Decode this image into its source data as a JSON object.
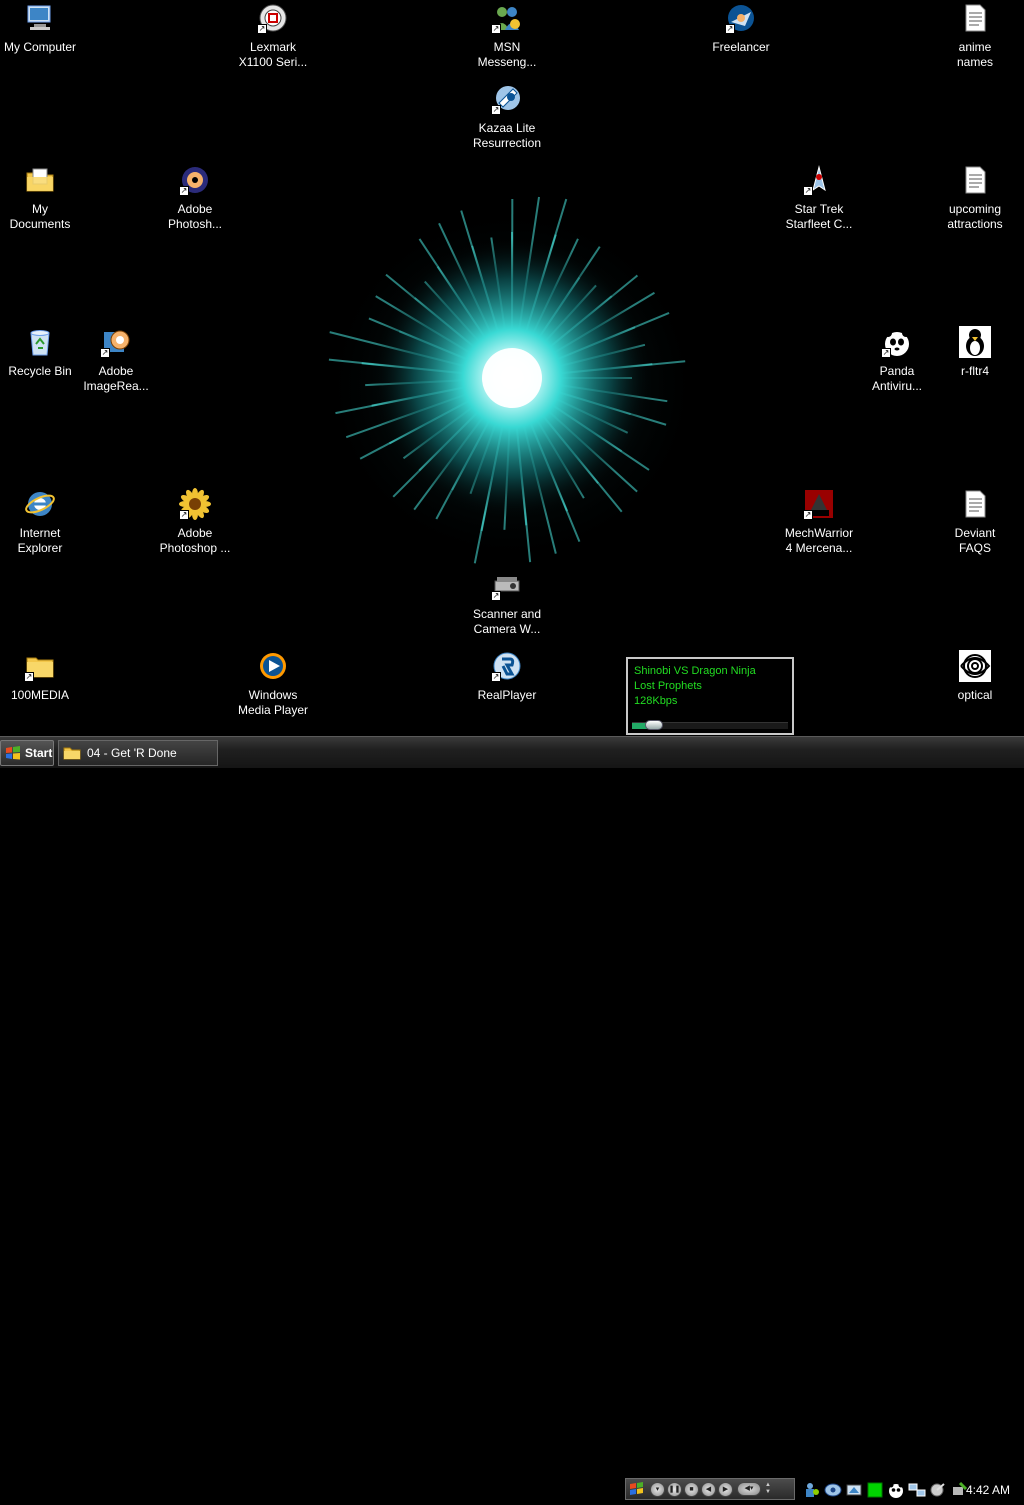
{
  "desktop": {
    "icons": [
      {
        "id": "my-computer",
        "label": "My Computer",
        "icon": "computer-icon",
        "shortcut": false
      },
      {
        "id": "lexmark",
        "label": "Lexmark\nX1100 Seri...",
        "icon": "printer-icon",
        "shortcut": true
      },
      {
        "id": "msn",
        "label": "MSN\nMesseng...",
        "icon": "msn-messenger-icon",
        "shortcut": true
      },
      {
        "id": "freelancer",
        "label": "Freelancer",
        "icon": "freelancer-game-icon",
        "shortcut": true
      },
      {
        "id": "anime-names",
        "label": "anime\nnames",
        "icon": "text-document-icon",
        "shortcut": false
      },
      {
        "id": "kazaa",
        "label": "Kazaa Lite\nResurrection",
        "icon": "kazaa-icon",
        "shortcut": true
      },
      {
        "id": "my-documents",
        "label": "My\nDocuments",
        "icon": "documents-folder-icon",
        "shortcut": false
      },
      {
        "id": "photoshop-album",
        "label": "Adobe\nPhotosh...",
        "icon": "photoshop-album-icon",
        "shortcut": true
      },
      {
        "id": "star-trek",
        "label": "Star Trek\nStarfleet C...",
        "icon": "starship-icon",
        "shortcut": true
      },
      {
        "id": "upcoming",
        "label": "upcoming\nattractions",
        "icon": "text-document-icon",
        "shortcut": false
      },
      {
        "id": "recycle-bin",
        "label": "Recycle Bin",
        "icon": "recycle-bin-icon",
        "shortcut": false
      },
      {
        "id": "imageready",
        "label": "Adobe\nImageRea...",
        "icon": "imageready-icon",
        "shortcut": true
      },
      {
        "id": "panda",
        "label": "Panda\nAntiviru...",
        "icon": "panda-icon",
        "shortcut": true
      },
      {
        "id": "r-fltr4",
        "label": "r-fltr4",
        "icon": "penguin-icon",
        "shortcut": false
      },
      {
        "id": "ie",
        "label": "Internet\nExplorer",
        "icon": "internet-explorer-icon",
        "shortcut": false
      },
      {
        "id": "photoshop",
        "label": "Adobe\nPhotoshop ...",
        "icon": "sunflower-icon",
        "shortcut": true
      },
      {
        "id": "mechwarrior",
        "label": "MechWarrior\n4 Mercena...",
        "icon": "mercs-game-icon",
        "shortcut": true
      },
      {
        "id": "deviant-faqs",
        "label": "Deviant\nFAQS",
        "icon": "text-document-icon",
        "shortcut": false
      },
      {
        "id": "scanner",
        "label": "Scanner and\nCamera W...",
        "icon": "scanner-camera-icon",
        "shortcut": true
      },
      {
        "id": "100media",
        "label": "100MEDIA",
        "icon": "folder-icon",
        "shortcut": true
      },
      {
        "id": "wmp",
        "label": "Windows\nMedia Player",
        "icon": "media-player-icon",
        "shortcut": false
      },
      {
        "id": "realplayer",
        "label": "RealPlayer",
        "icon": "realplayer-icon",
        "shortcut": true
      },
      {
        "id": "optical",
        "label": "optical",
        "icon": "spiral-image-icon",
        "shortcut": false
      }
    ]
  },
  "player_popup": {
    "title": "Shinobi VS Dragon Ninja",
    "artist": "Lost Prophets",
    "bitrate": "128Kbps",
    "progress": 0.12,
    "text_color": "#22dd22"
  },
  "taskbar": {
    "start_label": "Start",
    "tasks": [
      {
        "label": "04 - Get 'R Done",
        "icon": "folder-icon"
      }
    ],
    "media_buttons": [
      "stop-icon",
      "pause-icon",
      "stop-square-icon",
      "previous-icon",
      "next-icon",
      "volume-icon"
    ],
    "tray_icons": [
      "network-connection-icon",
      "messenger-tray-icon",
      "kazaa-tray-icon",
      "green-status-icon",
      "panda-tray-icon",
      "network-icon",
      "satellite-icon",
      "safely-remove-icon"
    ],
    "clock": "4:42 AM"
  },
  "colors": {
    "wallpaper_glow": "#36e8e0",
    "taskbar_bg": "#202020"
  }
}
